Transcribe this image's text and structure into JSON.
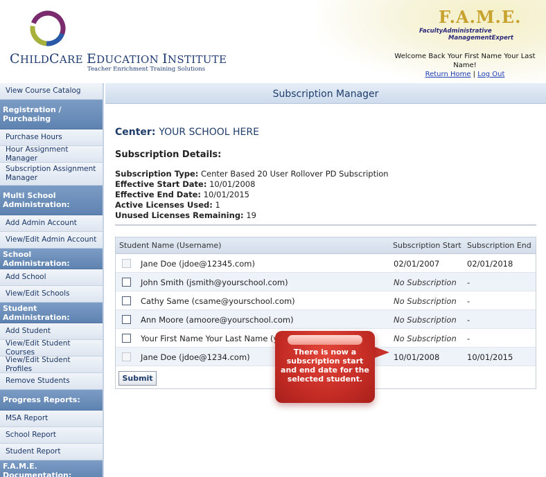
{
  "header": {
    "logo_name_big1": "C",
    "logo_name_small1": "HILD",
    "logo_name_big2": "C",
    "logo_name_small2": "ARE ",
    "logo_name_big3": "E",
    "logo_name_small3": "DUCATION ",
    "logo_name_big4": "I",
    "logo_name_small4": "NSTITUTE",
    "logo_tagline": "Teacher Enrichment Training Solutions",
    "fame_title": "F.A.M.E.",
    "fame_sub1": "FacultyAdministrative",
    "fame_sub2": "ManagementExpert",
    "welcome_text": "Welcome Back Your First Name Your Last Name!",
    "return_home": "Return Home",
    "separator": " | ",
    "log_out": "Log Out"
  },
  "sidebar": {
    "items": [
      {
        "type": "link",
        "label": "View Course Catalog",
        "h": 24
      },
      {
        "type": "head",
        "label": "Registration / Purchasing",
        "h": 43
      },
      {
        "type": "link",
        "label": "Purchase Hours",
        "h": 24
      },
      {
        "type": "link",
        "label": "Hour Assignment Manager",
        "h": 24
      },
      {
        "type": "link",
        "label": "Subscription Assignment Manager",
        "h": 33
      },
      {
        "type": "head",
        "label": "Multi School Administration:",
        "h": 43
      },
      {
        "type": "link",
        "label": "Add Admin Account",
        "h": 24
      },
      {
        "type": "link",
        "label": "View/Edit Admin Account",
        "h": 24
      },
      {
        "type": "head",
        "label": "School Administration:",
        "h": 30
      },
      {
        "type": "link",
        "label": "Add School",
        "h": 24
      },
      {
        "type": "link",
        "label": "View/Edit Schools",
        "h": 24
      },
      {
        "type": "head",
        "label": "Student Administration:",
        "h": 30
      },
      {
        "type": "link",
        "label": "Add Student",
        "h": 24
      },
      {
        "type": "link",
        "label": "View/Edit Student Courses",
        "h": 24
      },
      {
        "type": "link",
        "label": "View/Edit Student Profiles",
        "h": 24
      },
      {
        "type": "link",
        "label": "Remove Students",
        "h": 24
      },
      {
        "type": "head",
        "label": "Progress Reports:",
        "h": 30
      },
      {
        "type": "link",
        "label": "MSA Report",
        "h": 24
      },
      {
        "type": "link",
        "label": "School Report",
        "h": 24
      },
      {
        "type": "link",
        "label": "Student Report",
        "h": 24
      },
      {
        "type": "head",
        "label": "F.A.M.E. Documentation:",
        "h": 30
      }
    ]
  },
  "main": {
    "title": "Subscription Manager",
    "center_label": "Center:",
    "center_value": "YOUR SCHOOL HERE",
    "details_title": "Subscription Details:",
    "details": [
      {
        "label": "Subscription Type:",
        "value": "Center Based 20 User Rollover PD Subscription"
      },
      {
        "label": "Effective Start Date:",
        "value": "10/01/2008"
      },
      {
        "label": "Effective End Date:",
        "value": "10/01/2015"
      },
      {
        "label": "Active Licenses Used:",
        "value": "1"
      },
      {
        "label": "Unused Licenses Remaining:",
        "value": "19"
      }
    ],
    "table": {
      "headers": [
        "Student Name (Username)",
        "Subscription Start",
        "Subscription End"
      ],
      "rows": [
        {
          "name": "Jane Doe (jdoe@12345.com)",
          "start": "02/01/2007",
          "end": "02/01/2018",
          "disabled": true,
          "italic": false
        },
        {
          "name": "John Smith (jsmith@yourschool.com)",
          "start": "No Subscription",
          "end": "-",
          "disabled": false,
          "italic": true
        },
        {
          "name": "Cathy Same (csame@yourschool.com)",
          "start": "No Subscription",
          "end": "-",
          "disabled": false,
          "italic": true
        },
        {
          "name": "Ann Moore (amoore@yourschool.com)",
          "start": "No Subscription",
          "end": "-",
          "disabled": false,
          "italic": true
        },
        {
          "name": "Your First Name Your Last Name (y",
          "start": "No Subscription",
          "end": "-",
          "disabled": false,
          "italic": true
        },
        {
          "name": "Jane Doe (jdoe@1234.com)",
          "start": "10/01/2008",
          "end": "10/01/2015",
          "disabled": true,
          "italic": false
        }
      ],
      "submit_label": "Submit"
    }
  },
  "callout": {
    "text": "There is now a subscription start and end date for the selected student."
  },
  "colors": {
    "accent": "#1f3d6b",
    "callout_red": "#c72e26",
    "nav_head": "#6a8cb9"
  }
}
